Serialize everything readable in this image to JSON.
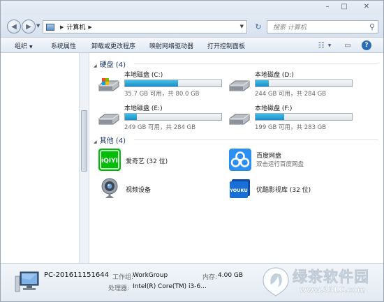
{
  "window": {
    "controls": {
      "minimize": "–",
      "maximize": "□",
      "close": "✕"
    }
  },
  "address": {
    "path": "计算机",
    "search_placeholder": "搜索 计算机"
  },
  "toolbar": {
    "organize": "组织",
    "system_properties": "系统属性",
    "uninstall": "卸载或更改程序",
    "map_drive": "映射网络驱动器",
    "control_panel": "打开控制面板"
  },
  "content": {
    "drives_header": "硬盘 (4)",
    "others_header": "其他 (4)",
    "drives": [
      {
        "name": "本地磁盘 (C:)",
        "free": "35.7 GB 可用，共 80.0 GB",
        "used_fraction": 0.55,
        "icon": "system-drive-icon"
      },
      {
        "name": "本地磁盘 (D:)",
        "free": "244 GB 可用，共 284 GB",
        "used_fraction": 0.14,
        "icon": "hard-drive-icon"
      },
      {
        "name": "本地磁盘 (E:)",
        "free": "249 GB 可用，共 284 GB",
        "used_fraction": 0.12,
        "icon": "hard-drive-icon"
      },
      {
        "name": "本地磁盘 (F:)",
        "free": "199 GB 可用，共 283 GB",
        "used_fraction": 0.3,
        "icon": "hard-drive-icon"
      }
    ],
    "others": [
      {
        "name": "爱奇艺 (32 位)",
        "icon": "iqiyi-icon",
        "logo_text": "iQIYI"
      },
      {
        "name": "百度网盘",
        "sub": "双击运行百度网盘",
        "icon": "baidu-netdisk-icon"
      },
      {
        "name": "视频设备",
        "icon": "webcam-icon"
      },
      {
        "name": "优酷影视库 (32 位)",
        "icon": "youku-icon",
        "logo_text": "YOUKU"
      }
    ]
  },
  "details": {
    "pc_name": "PC-201611151644",
    "workgroup_label": "工作组:",
    "workgroup": "WorkGroup",
    "memory_label": "内存:",
    "memory": "4.00 GB",
    "cpu_label": "处理器:",
    "cpu": "Intel(R) Core(TM) i3-6..."
  },
  "watermark": {
    "brand": "绿茶软件园",
    "url": "www.33LC.com"
  },
  "colors": {
    "accent_blue": "#1d8ec2",
    "header_blue": "#1e3a6e",
    "iqiyi_green": "#00be06",
    "baidu_blue": "#2a8ff0",
    "youku_blue": "#1a6fd6"
  }
}
